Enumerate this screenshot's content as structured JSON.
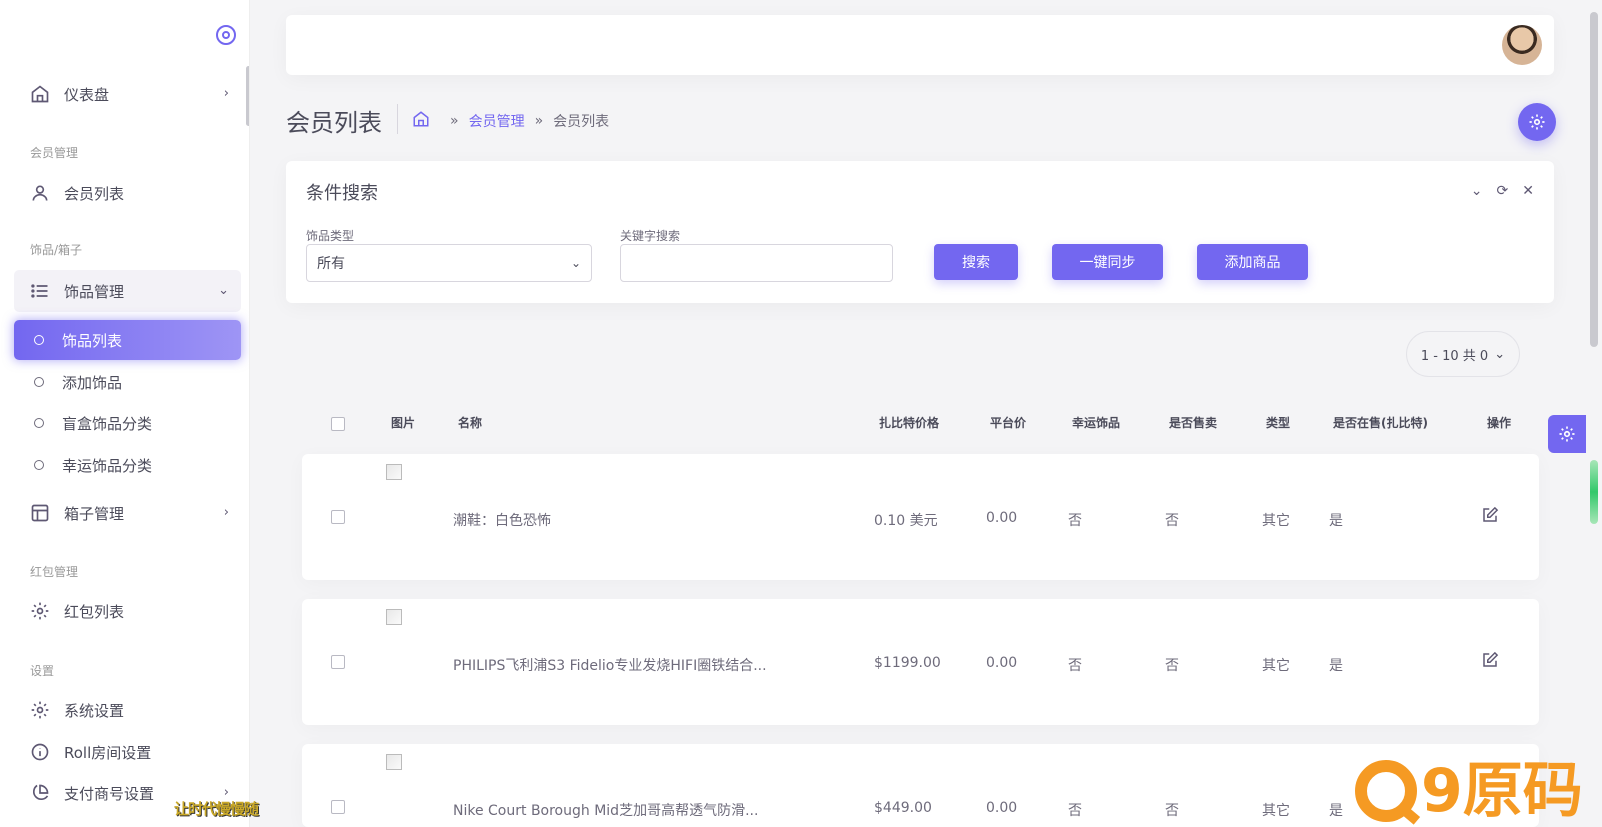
{
  "sidebar": {
    "dashboard": "仪表盘",
    "sec_member": "会员管理",
    "member_list": "会员列表",
    "sec_items": "饰品/箱子",
    "item_mgmt": "饰品管理",
    "item_list": "饰品列表",
    "add_item": "添加饰品",
    "blindbox_cat": "盲盒饰品分类",
    "lucky_cat": "幸运饰品分类",
    "box_mgmt": "箱子管理",
    "sec_redpacket": "红包管理",
    "redpacket_list": "红包列表",
    "sec_settings": "设置",
    "sys_settings": "系统设置",
    "roll_settings": "Roll房间设置",
    "pay_settings": "支付商号设置"
  },
  "header": {
    "title": "会员列表",
    "breadcrumb": {
      "parent": "会员管理",
      "sep": "»",
      "current": "会员列表"
    }
  },
  "search": {
    "title": "条件搜索",
    "type_label": "饰品类型",
    "type_value": "所有",
    "keyword_label": "关键字搜索",
    "keyword_value": "",
    "btn_search": "搜索",
    "btn_sync": "一键同步",
    "btn_add": "添加商品"
  },
  "pager": {
    "text": "1 - 10 共 0"
  },
  "table": {
    "headers": [
      "图片",
      "名称",
      "扎比特价格",
      "平台价",
      "幸运饰品",
      "是否售卖",
      "类型",
      "是否在售(扎比特)",
      "操作"
    ],
    "rows": [
      {
        "name": "潮鞋：白色恐怖",
        "zbt_price": "0.10 美元",
        "platform_price": "0.00",
        "lucky": "否",
        "for_sale": "否",
        "type": "其它",
        "on_sale_zbt": "是"
      },
      {
        "name": "PHILIPS飞利浦S3 Fidelio专业发烧HIFI圈铁结合...",
        "zbt_price": "$1199.00",
        "platform_price": "0.00",
        "lucky": "否",
        "for_sale": "否",
        "type": "其它",
        "on_sale_zbt": "是"
      },
      {
        "name": "Nike Court Borough Mid芝加哥高帮透气防滑...",
        "zbt_price": "$449.00",
        "platform_price": "0.00",
        "lucky": "否",
        "for_sale": "否",
        "type": "其它",
        "on_sale_zbt": "是"
      }
    ]
  },
  "watermark": {
    "left_text": "让时代慢慢随",
    "logo_text": "9原码"
  },
  "colors": {
    "primary": "#7367f0",
    "watermark": "#f59a23"
  }
}
